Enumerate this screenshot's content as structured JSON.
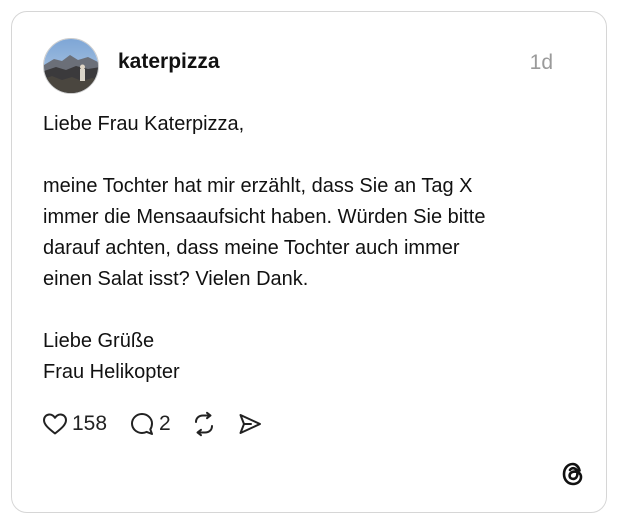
{
  "post": {
    "username": "katerpizza",
    "time": "1d",
    "text": "Liebe Frau Katerpizza,\n\nmeine Tochter hat mir erzählt, dass Sie an Tag X\nimmer die Mensaaufsicht haben. Würden Sie bitte\ndarauf achten, dass meine Tochter auch immer\neinen Salat isst? Vielen Dank.\n\nLiebe Grüße\nFrau Helikopter",
    "likes": "158",
    "replies": "2"
  },
  "icons": {
    "like": "heart-icon",
    "reply": "comment-bubble-icon",
    "repost": "repost-icon",
    "share": "send-icon",
    "brand": "threads-logo-icon"
  }
}
